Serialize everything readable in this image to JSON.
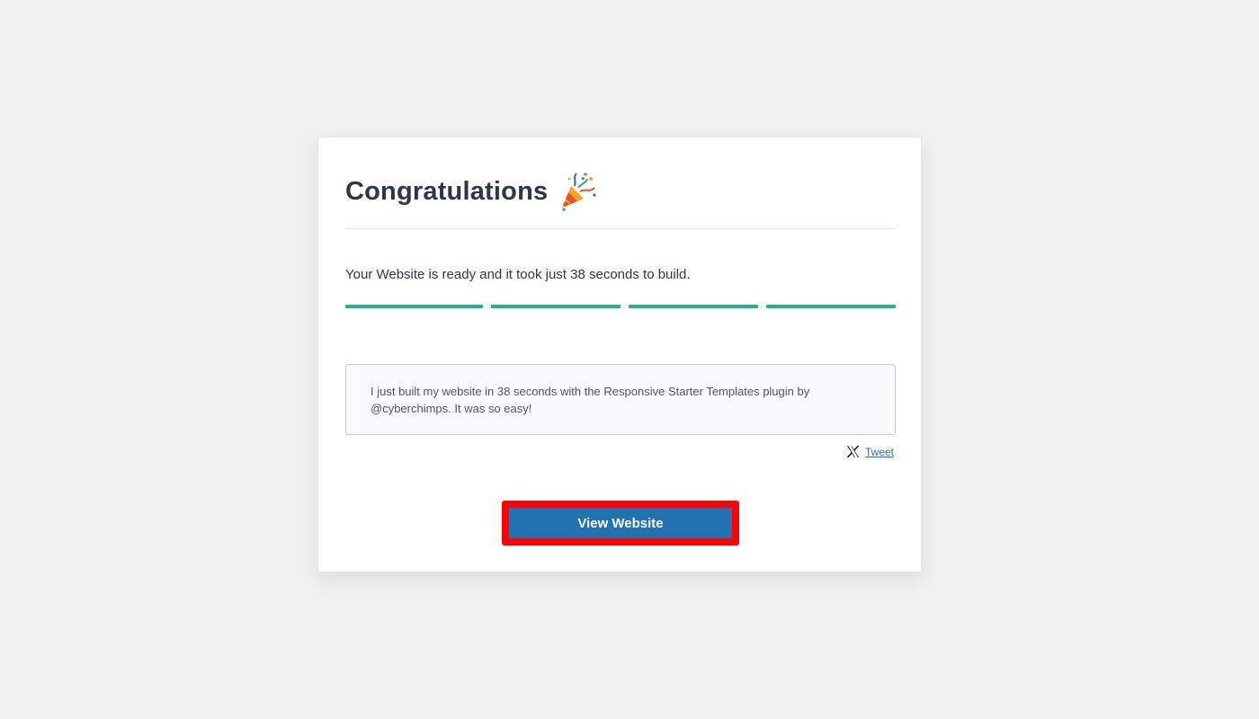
{
  "card": {
    "title": "Congratulations",
    "title_icon": "party-popper-icon",
    "ready_message": "Your Website is ready and it took just 38 seconds to build.",
    "progress": {
      "segments_complete": 4,
      "segments_total": 4,
      "color": "#24b47e"
    },
    "tweet_text": "I just built my website in 38 seconds with the Responsive Starter Templates plugin by @cyberchimps. It was so easy!",
    "tweet_link_label": "Tweet",
    "tweet_icon": "x-logo-icon",
    "view_button_label": "View Website",
    "view_button_color": "#2271b1",
    "highlight_color": "#ff0000"
  }
}
